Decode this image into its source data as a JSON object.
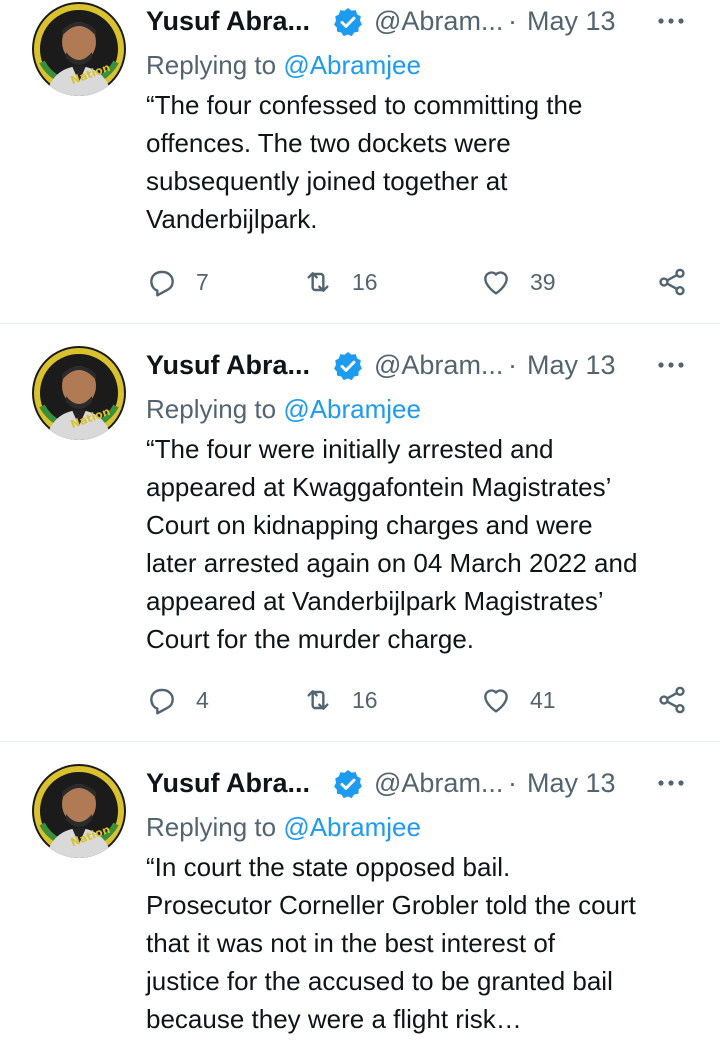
{
  "tweets": [
    {
      "name": "Yusuf Abra...",
      "handle": "@Abram...",
      "separator": "·",
      "date": "May 13",
      "replying_prefix": "Replying to ",
      "replying_handle": "@Abramjee",
      "text": "“The four confessed to committing the\noffences. The two dockets were\nsubsequently joined together at\nVanderbijlpark.",
      "replies": "7",
      "retweets": "16",
      "likes": "39"
    },
    {
      "name": "Yusuf Abra...",
      "handle": "@Abram...",
      "separator": "·",
      "date": "May 13",
      "replying_prefix": "Replying to ",
      "replying_handle": "@Abramjee",
      "text": "“The four were initially arrested and\nappeared at Kwaggafontein Magistrates’\nCourt on kidnapping charges and were\nlater arrested again on 04 March 2022 and\nappeared at Vanderbijlpark Magistrates’\nCourt for the murder charge.",
      "replies": "4",
      "retweets": "16",
      "likes": "41"
    },
    {
      "name": "Yusuf Abra...",
      "handle": "@Abram...",
      "separator": "·",
      "date": "May 13",
      "replying_prefix": "Replying to ",
      "replying_handle": "@Abramjee",
      "text": "“In court the state opposed  bail.\nProsecutor Corneller Grobler told the court\nthat it was not in the best interest of\njustice for the accused to be granted bail\nbecause they were a flight risk…"
    }
  ],
  "avatar_badge_text": "Nation",
  "colors": {
    "accent": "#1d9bf0",
    "muted": "#536471",
    "text": "#0f1419",
    "divider": "#e6ecf0"
  }
}
